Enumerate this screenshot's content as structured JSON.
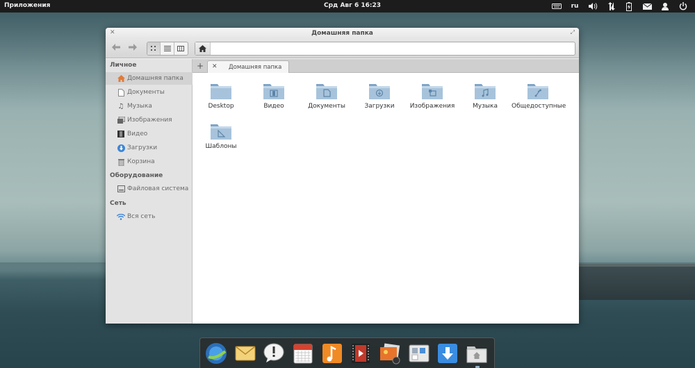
{
  "panel": {
    "apps_label": "Приложения",
    "clock": "Срд Авг  6 16:23",
    "keyboard_layout": "ru"
  },
  "window": {
    "title": "Домашняя папка"
  },
  "toolbar": {
    "view_modes": [
      "icons",
      "list",
      "columns"
    ],
    "active_view": "icons"
  },
  "sidebar": {
    "sections": [
      {
        "header": "Личное",
        "items": [
          {
            "label": "Домашняя папка",
            "icon": "home-icon",
            "selected": true
          },
          {
            "label": "Документы",
            "icon": "document-icon"
          },
          {
            "label": "Музыка",
            "icon": "music-note-icon"
          },
          {
            "label": "Изображения",
            "icon": "image-icon"
          },
          {
            "label": "Видео",
            "icon": "film-icon"
          },
          {
            "label": "Загрузки",
            "icon": "download-icon"
          },
          {
            "label": "Корзина",
            "icon": "trash-icon"
          }
        ]
      },
      {
        "header": "Оборудование",
        "items": [
          {
            "label": "Файловая система",
            "icon": "drive-icon"
          }
        ]
      },
      {
        "header": "Сеть",
        "items": [
          {
            "label": "Вся сеть",
            "icon": "wifi-icon"
          }
        ]
      }
    ]
  },
  "tabs": [
    {
      "label": "Домашняя папка"
    }
  ],
  "files": [
    {
      "name": "Desktop",
      "emblem": "none"
    },
    {
      "name": "Видео",
      "emblem": "film"
    },
    {
      "name": "Документы",
      "emblem": "document"
    },
    {
      "name": "Загрузки",
      "emblem": "download"
    },
    {
      "name": "Изображения",
      "emblem": "image"
    },
    {
      "name": "Музыка",
      "emblem": "music"
    },
    {
      "name": "Общедоступные",
      "emblem": "share"
    },
    {
      "name": "Шаблоны",
      "emblem": "template"
    }
  ],
  "dock": {
    "apps": [
      "browser-icon",
      "mail-icon",
      "chat-icon",
      "calendar-icon",
      "music-icon",
      "video-icon",
      "photos-icon",
      "settings-icon",
      "software-center-icon",
      "files-icon"
    ]
  },
  "colors": {
    "folder_top": "#a7c3db",
    "folder_body": "#7fa4c6",
    "panel_bg": "#1c1c1c"
  }
}
